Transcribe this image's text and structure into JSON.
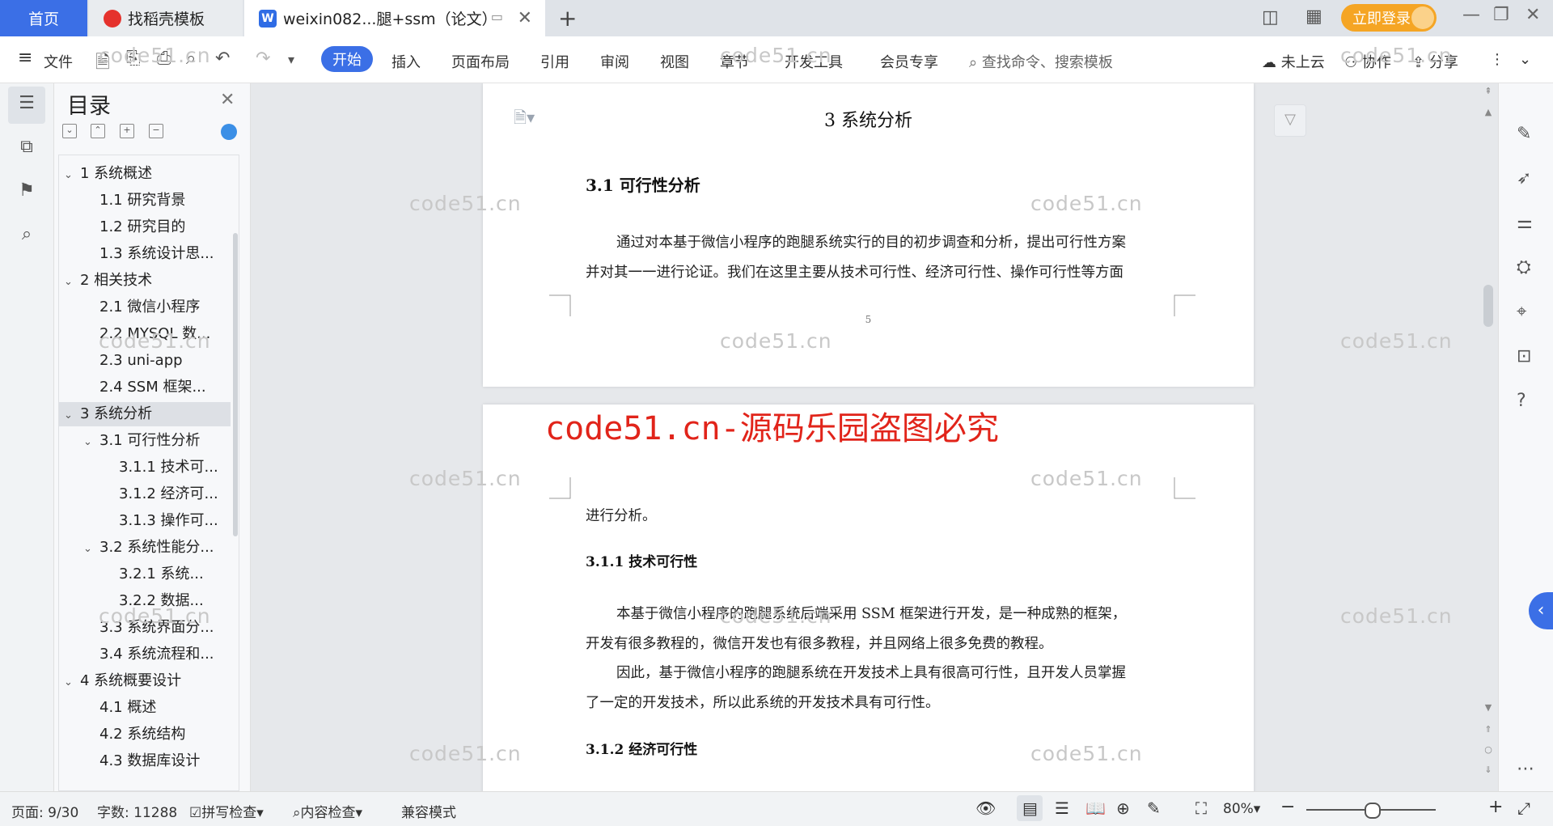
{
  "tabs": {
    "home": "首页",
    "docer": "找稻壳模板",
    "doc_title": "weixin082...腿+ssm（论文）",
    "doc_icon": "W",
    "login": "立即登录"
  },
  "ribbon": {
    "file": "文件",
    "start": "开始",
    "items": [
      "插入",
      "页面布局",
      "引用",
      "审阅",
      "视图",
      "章节",
      "开发工具",
      "会员专享"
    ],
    "search_placeholder": "查找命令、搜索模板",
    "cloud": "未上云",
    "collab": "协作",
    "share": "分享"
  },
  "toc": {
    "title": "目录",
    "items": [
      {
        "label": "1 系统概述",
        "expanded": true
      },
      {
        "label": "1.1  研究背景"
      },
      {
        "label": "1.2 研究目的"
      },
      {
        "label": "1.3 系统设计思..."
      },
      {
        "label": "2 相关技术",
        "expanded": true
      },
      {
        "label": "2.1 微信小程序"
      },
      {
        "label": "2.2 MYSQL 数..."
      },
      {
        "label": "2.3 uni-app"
      },
      {
        "label": "2.4 SSM 框架..."
      },
      {
        "label": "3 系统分析",
        "expanded": true,
        "selected": true
      },
      {
        "label": "3.1 可行性分析",
        "expanded": true
      },
      {
        "label": "3.1.1 技术可..."
      },
      {
        "label": "3.1.2 经济可..."
      },
      {
        "label": "3.1.3 操作可..."
      },
      {
        "label": "3.2 系统性能分...",
        "expanded": true
      },
      {
        "label": "3.2.1  系统..."
      },
      {
        "label": "3.2.2  数据..."
      },
      {
        "label": "3.3 系统界面分..."
      },
      {
        "label": "3.4 系统流程和..."
      },
      {
        "label": "4 系统概要设计",
        "expanded": true
      },
      {
        "label": "4.1 概述"
      },
      {
        "label": "4.2 系统结构"
      },
      {
        "label": "4.3 数据库设计"
      }
    ]
  },
  "page1": {
    "chapter_title": "3 系统分析",
    "section": "3.1 可行性分析",
    "para1_line1": "通过对本基于微信小程序的跑腿系统实行的目的初步调查和分析，提出可行性方案",
    "para1_line2": "并对其一一进行论证。我们在这里主要从技术可行性、经济可行性、操作可行性等方面",
    "page_number": "5"
  },
  "page2": {
    "cont": "进行分析。",
    "sub1": "3.1.1 技术可行性",
    "p2_l1": "本基于微信小程序的跑腿系统后端采用 SSM 框架进行开发，是一种成熟的框架，",
    "p2_l2": "开发有很多教程的，微信开发也有很多教程，并且网络上很多免费的教程。",
    "p3_l1": "因此，基于微信小程序的跑腿系统在开发技术上具有很高可行性，且开发人员掌握",
    "p3_l2": "了一定的开发技术，所以此系统的开发技术具有可行性。",
    "sub2": "3.1.2 经济可行性"
  },
  "watermark": {
    "text": "code51.cn",
    "red": "code51.cn-源码乐园盗图必究"
  },
  "status": {
    "page": "页面: 9/30",
    "words": "字数: 11288",
    "spell": "拼写检查",
    "content_check": "内容检查",
    "compat": "兼容模式",
    "zoom": "80%"
  },
  "colors": {
    "accent": "#3b6fe6",
    "login": "#f5a524",
    "red_watermark": "#e1241a"
  }
}
